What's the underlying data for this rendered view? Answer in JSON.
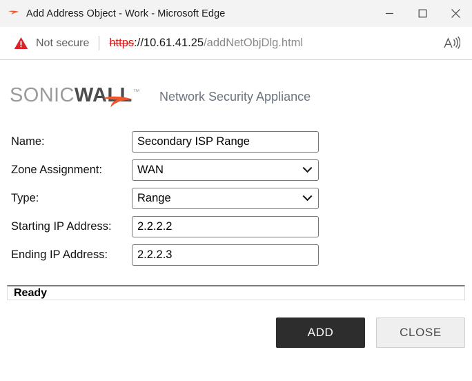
{
  "window": {
    "title": "Add Address Object - Work - Microsoft Edge",
    "favicon": "sonicwall-swoosh-icon",
    "controls": {
      "minimize": "minimize-icon",
      "maximize": "maximize-icon",
      "close": "close-icon"
    }
  },
  "addressbar": {
    "security_icon": "not-secure-warning-icon",
    "security_label": "Not secure",
    "url_scheme": "https",
    "url_host": "://10.61.41.25",
    "url_path": "/addNetObjDlg.html",
    "read_aloud_icon": "read-aloud-icon",
    "colors": {
      "scheme": "#d01b1b",
      "host": "#1b1b1b",
      "path": "#8a8a8a"
    }
  },
  "brand": {
    "logo_part1": "SONIC",
    "logo_part2": "WALL",
    "trademark": "™",
    "tagline": "Network Security Appliance",
    "swoosh_icon": "sonicwall-swoosh-icon",
    "colors": {
      "sonic": "#9b9b9b",
      "wall": "#4d4d4d",
      "swoosh": "#f0562d",
      "tagline": "#6c7480"
    }
  },
  "form": {
    "fields": [
      {
        "label": "Name:",
        "control": "text",
        "value": "Secondary ISP Range",
        "placeholder": "",
        "name": "name"
      },
      {
        "label": "Zone Assignment:",
        "control": "select",
        "value": "WAN",
        "placeholder": "",
        "name": "zone-assignment"
      },
      {
        "label": "Type:",
        "control": "select",
        "value": "Range",
        "placeholder": "",
        "name": "type"
      },
      {
        "label": "Starting IP Address:",
        "control": "text",
        "value": "2.2.2.2",
        "placeholder": "",
        "name": "starting-ip-address"
      },
      {
        "label": "Ending IP Address:",
        "control": "text",
        "value": "2.2.2.3",
        "placeholder": "",
        "name": "ending-ip-address"
      }
    ]
  },
  "status": {
    "text": "Ready"
  },
  "actions": {
    "primary_label": "ADD",
    "secondary_label": "CLOSE",
    "colors": {
      "primary_bg": "#2d2d2d",
      "primary_fg": "#ffffff",
      "secondary_bg": "#efefef",
      "secondary_fg": "#4a4a4a"
    }
  }
}
